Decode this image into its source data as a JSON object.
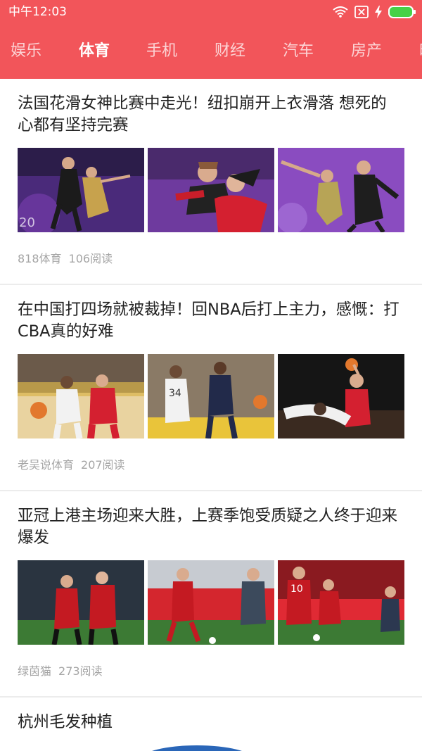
{
  "status_bar": {
    "time": "中午12:03",
    "icons": [
      "wifi-icon",
      "sim-no-signal-icon",
      "charging-bolt-icon",
      "battery-icon"
    ],
    "bar_color": "#f2555a"
  },
  "tabs": [
    {
      "label": "娱乐",
      "active": false
    },
    {
      "label": "体育",
      "active": true
    },
    {
      "label": "手机",
      "active": false
    },
    {
      "label": "财经",
      "active": false
    },
    {
      "label": "汽车",
      "active": false
    },
    {
      "label": "房产",
      "active": false
    },
    {
      "label": "时",
      "active": false
    }
  ],
  "articles": [
    {
      "title": "法国花滑女神比赛中走光！纽扣崩开上衣滑落 想死的心都有坚持完赛",
      "source": "818体育",
      "reads": "106阅读",
      "images": [
        "figure-skating-photo",
        "figure-skating-photo",
        "figure-skating-photo"
      ]
    },
    {
      "title": "在中国打四场就被裁掉！回NBA后打上主力，感慨：打CBA真的好难",
      "source": "老吴说体育",
      "reads": "207阅读",
      "images": [
        "basketball-photo",
        "basketball-photo",
        "basketball-photo"
      ]
    },
    {
      "title": "亚冠上港主场迎来大胜，上赛季饱受质疑之人终于迎来爆发",
      "source": "绿茵猫",
      "reads": "273阅读",
      "images": [
        "football-photo",
        "football-photo",
        "football-photo"
      ]
    },
    {
      "title": "杭州毛发种植",
      "source": "",
      "reads": "",
      "images": []
    }
  ],
  "colors": {
    "accent": "#f2555a",
    "title_text": "#222222",
    "meta_text": "#a5a5a5",
    "divider": "#ececec"
  }
}
